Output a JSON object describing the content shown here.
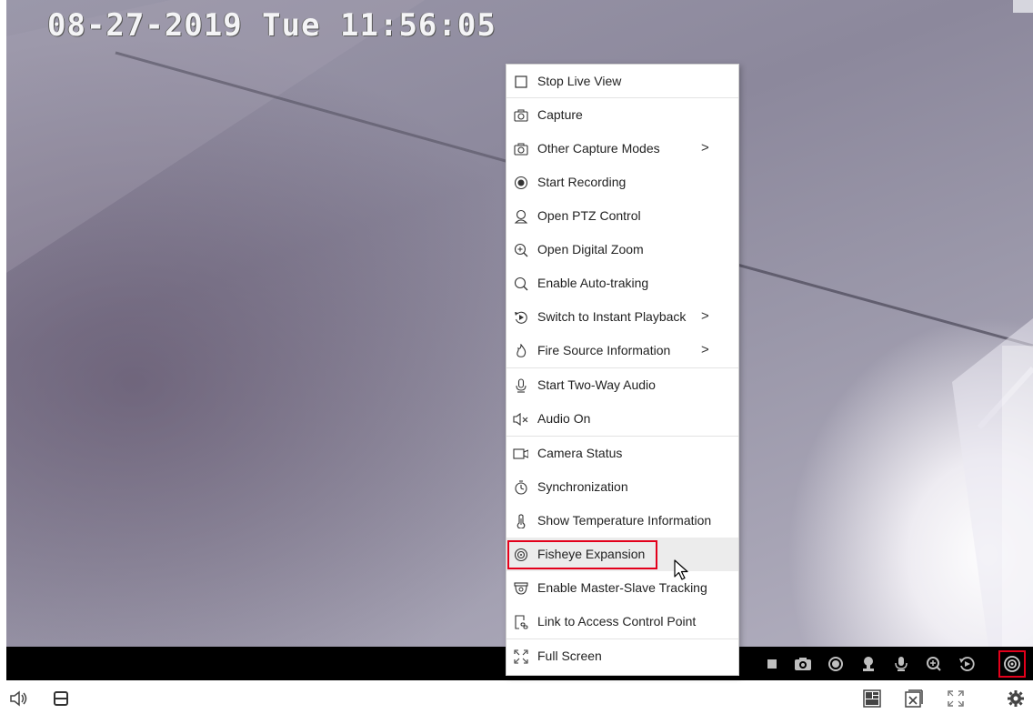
{
  "osd": {
    "datetime": "08-27-2019 Tue 11:56:05"
  },
  "context_menu": {
    "items": [
      {
        "label": "Stop Live View",
        "icon": "square-icon"
      },
      {
        "label": "Capture",
        "icon": "camera-icon"
      },
      {
        "label": "Other Capture Modes",
        "icon": "camera-icon",
        "submenu_arrow": ">"
      },
      {
        "label": "Start Recording",
        "icon": "record-icon"
      },
      {
        "label": "Open PTZ Control",
        "icon": "ptz-icon"
      },
      {
        "label": "Open Digital Zoom",
        "icon": "zoom-in-icon"
      },
      {
        "label": "Enable Auto-traking",
        "icon": "search-icon"
      },
      {
        "label": "Switch to Instant Playback",
        "icon": "playback-icon",
        "submenu_arrow": ">"
      },
      {
        "label": "Fire Source Information",
        "icon": "flame-icon",
        "submenu_arrow": ">"
      },
      {
        "label": "Start Two-Way Audio",
        "icon": "microphone-icon"
      },
      {
        "label": "Audio On",
        "icon": "speaker-muted-icon"
      },
      {
        "label": "Camera Status",
        "icon": "video-camera-icon"
      },
      {
        "label": "Synchronization",
        "icon": "stopwatch-icon"
      },
      {
        "label": "Show Temperature Information",
        "icon": "thermometer-icon"
      },
      {
        "label": "Fisheye Expansion",
        "icon": "fisheye-icon",
        "highlighted": true
      },
      {
        "label": "Enable Master-Slave Tracking",
        "icon": "dome-camera-icon"
      },
      {
        "label": "Link to Access Control Point",
        "icon": "door-link-icon"
      },
      {
        "label": "Full Screen",
        "icon": "fullscreen-icon"
      }
    ]
  },
  "video_toolbar": {
    "buttons": [
      "stop-icon",
      "camera-icon",
      "record-icon",
      "ptz-icon",
      "microphone-icon",
      "zoom-in-icon",
      "playback-icon",
      "fisheye-icon"
    ],
    "active": "fisheye-icon"
  },
  "bottom_bar": {
    "left": [
      "speaker-muted-icon",
      "save-icon"
    ],
    "right": [
      "layout-icon",
      "close-all-icon",
      "fullscreen-icon",
      "settings-gear-icon"
    ]
  },
  "colors": {
    "highlight_border": "#e3001b",
    "toolbar_bg": "#000000",
    "menu_hover": "#ececec"
  }
}
